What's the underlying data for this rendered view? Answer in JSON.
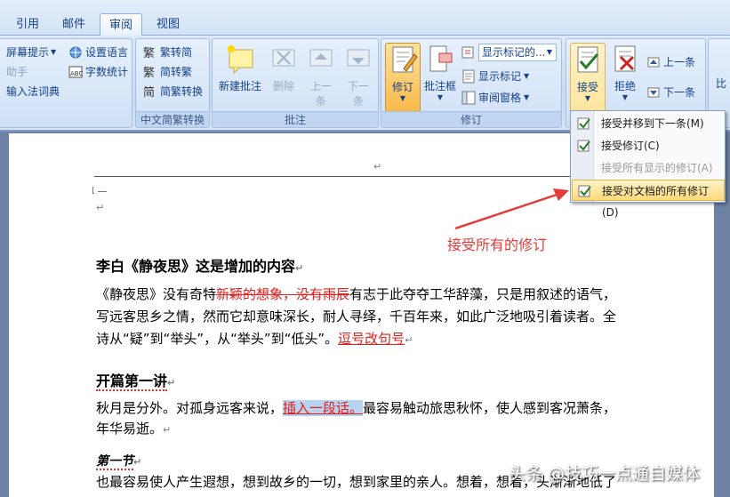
{
  "tabs": [
    "引用",
    "邮件",
    "审阅",
    "视图"
  ],
  "ribbon": {
    "proofing": {
      "items": [
        "屏幕提示",
        "助手",
        "输入法词典",
        "设置语言",
        "字数统计"
      ]
    },
    "chinese_conversion": {
      "items": [
        "繁转简",
        "简转繁",
        "简繁转换"
      ],
      "label": "中文简繁转换"
    },
    "comments": {
      "new": "新建批注",
      "delete": "删除",
      "prev_1": "上一",
      "prev_2": "条",
      "next_1": "下一",
      "next_2": "条",
      "label": "批注"
    },
    "tracking": {
      "track": "修订",
      "balloons": "批注框",
      "display_combo": "显示标记的...",
      "show_markup": "显示标记",
      "reviewing_pane": "审阅窗格",
      "label": "修订"
    },
    "changes": {
      "accept": "接受",
      "reject": "拒绝",
      "prev": "上一条",
      "next": "下一条"
    },
    "overflow": "比"
  },
  "dropdown": {
    "items": [
      "接受并移到下一条(M)",
      "接受修订(C)",
      "接受所有显示的修订(A)",
      "接受对文档的所有修订(D)"
    ]
  },
  "annotation": "接受所有的修订",
  "document": {
    "heading1": "李白《静夜思》这是增加的内容",
    "p1_a": "《静夜思》没有奇特",
    "p1_del": "新颖的想象，没有雨辰",
    "p1_b": "有志于此夺夺工华辞藻，只是用叙述的语气，",
    "p1_line2": "写远客思乡之情，然而它却意味深长，耐人寻绎，千百年来，如此广泛地吸引着读者。全",
    "p1_line3": "诗从“疑”到“举头”，从“举头”到“低头”。",
    "p1_ins": "逗号改句号",
    "heading2": "开篇第一讲",
    "p2_a": "秋月是分外。对孤身远客来说，",
    "p2_ins": "插入一段话。",
    "p2_b": "最容易触动旅思秋怀，使人感到客况萧条，",
    "p2_line2": "年华易逝。",
    "heading3": "第一节",
    "p3": "也最容易使人产生遐想，想到故乡的一切，想到家里的亲人。想着，想着，头渐渐地低了"
  },
  "watermark": "头条 @技巧一点通自媒体",
  "colors": {
    "ribbon_text": "#15428b",
    "revision_red": "#e0201c",
    "highlight_gold": "#ffd97a"
  }
}
